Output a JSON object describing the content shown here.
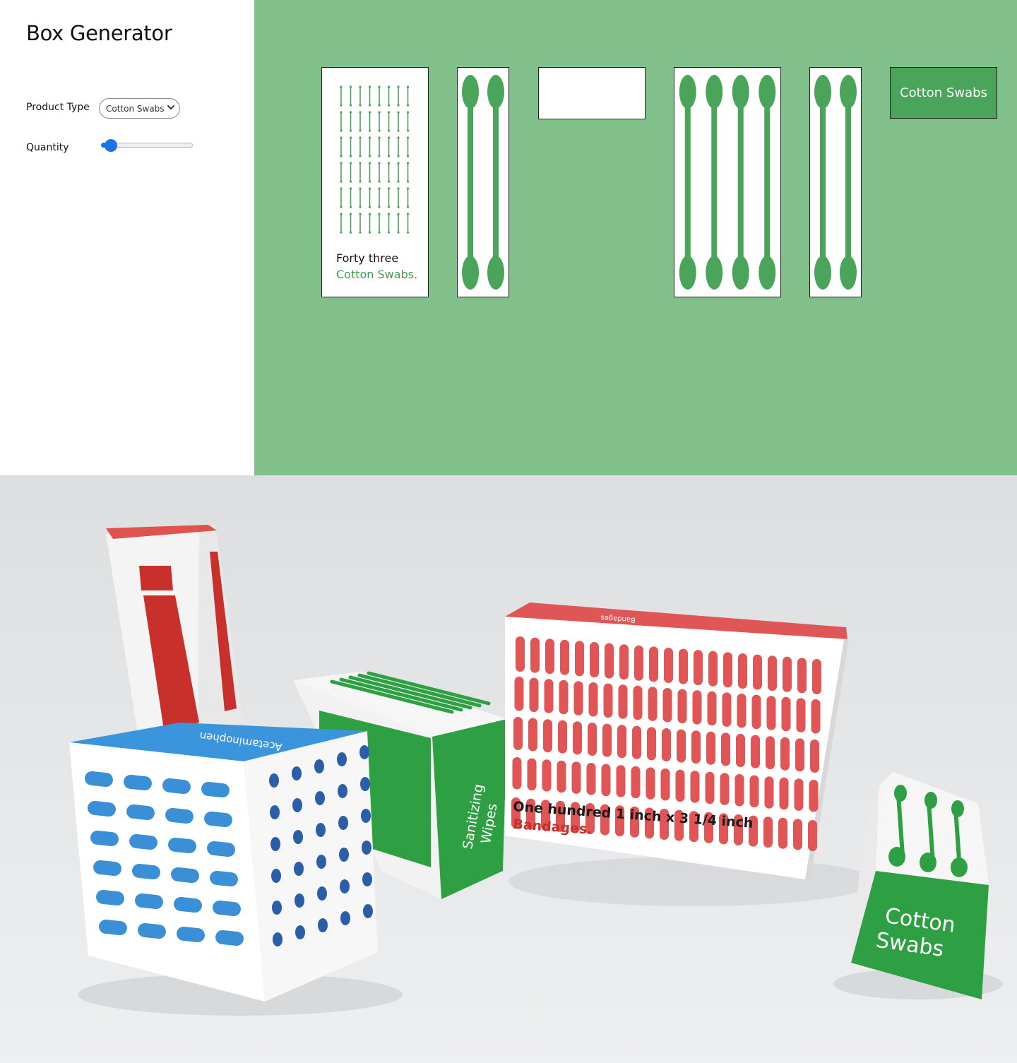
{
  "app": {
    "title": "Box Generator"
  },
  "controls": {
    "product_type": {
      "label": "Product Type",
      "selected": "Cotton Swabs"
    },
    "quantity": {
      "label": "Quantity",
      "level": 0.08
    }
  },
  "preview": {
    "background": "#82c08b",
    "accent": "#4aa55a",
    "front": {
      "count_text": "Forty three",
      "product_text": "Cotton Swabs."
    },
    "label_panel": {
      "text": "Cotton Swabs"
    }
  },
  "photo": {
    "background": "#e8e9ea",
    "boxes": [
      {
        "kind": "bandage-box",
        "front_line": "One hundred 1 inch x 3 1/4 inch",
        "product": "Bandages.",
        "top_label": "Bandages",
        "color": "#e05555"
      },
      {
        "kind": "pill-box",
        "top_label": "Acetaminophen",
        "color": "#3a8fd6"
      },
      {
        "kind": "wipes-box",
        "side_label": "Sanitizing Wipes",
        "color": "#2ea043"
      },
      {
        "kind": "swab-box",
        "front_label": "Cotton Swabs",
        "color": "#2ea043"
      },
      {
        "kind": "tall-box",
        "color": "#c8302c"
      }
    ]
  }
}
